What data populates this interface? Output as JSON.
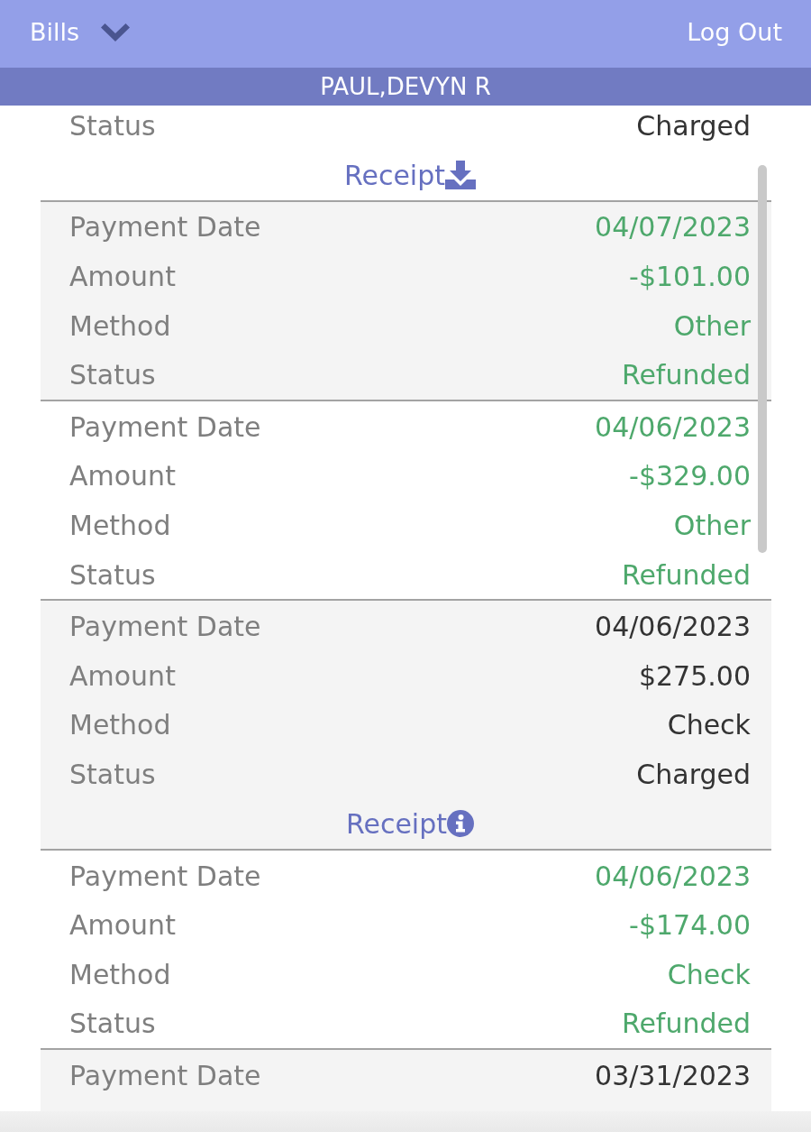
{
  "header": {
    "menu": "Bills",
    "action": "Log Out"
  },
  "patient": "PAUL,DEVYN R",
  "payments": [
    {
      "kind": "charge",
      "fields": [
        {
          "label": "Status",
          "value": "Charged"
        }
      ],
      "receipt": {
        "label": "Receipt",
        "kind": "download"
      }
    },
    {
      "kind": "refund",
      "fields": [
        {
          "label": "Payment Date",
          "value": "04/07/2023"
        },
        {
          "label": "Amount",
          "value": "-$101.00"
        },
        {
          "label": "Method",
          "value": "Other"
        },
        {
          "label": "Status",
          "value": "Refunded"
        }
      ]
    },
    {
      "kind": "refund",
      "fields": [
        {
          "label": "Payment Date",
          "value": "04/06/2023"
        },
        {
          "label": "Amount",
          "value": "-$329.00"
        },
        {
          "label": "Method",
          "value": "Other"
        },
        {
          "label": "Status",
          "value": "Refunded"
        }
      ]
    },
    {
      "kind": "charge",
      "fields": [
        {
          "label": "Payment Date",
          "value": "04/06/2023"
        },
        {
          "label": "Amount",
          "value": "$275.00"
        },
        {
          "label": "Method",
          "value": "Check"
        },
        {
          "label": "Status",
          "value": "Charged"
        }
      ],
      "receipt": {
        "label": "Receipt",
        "kind": "info"
      }
    },
    {
      "kind": "refund",
      "fields": [
        {
          "label": "Payment Date",
          "value": "04/06/2023"
        },
        {
          "label": "Amount",
          "value": "-$174.00"
        },
        {
          "label": "Method",
          "value": "Check"
        },
        {
          "label": "Status",
          "value": "Refunded"
        }
      ]
    },
    {
      "kind": "charge",
      "fields": [
        {
          "label": "Payment Date",
          "value": "03/31/2023"
        }
      ]
    }
  ]
}
